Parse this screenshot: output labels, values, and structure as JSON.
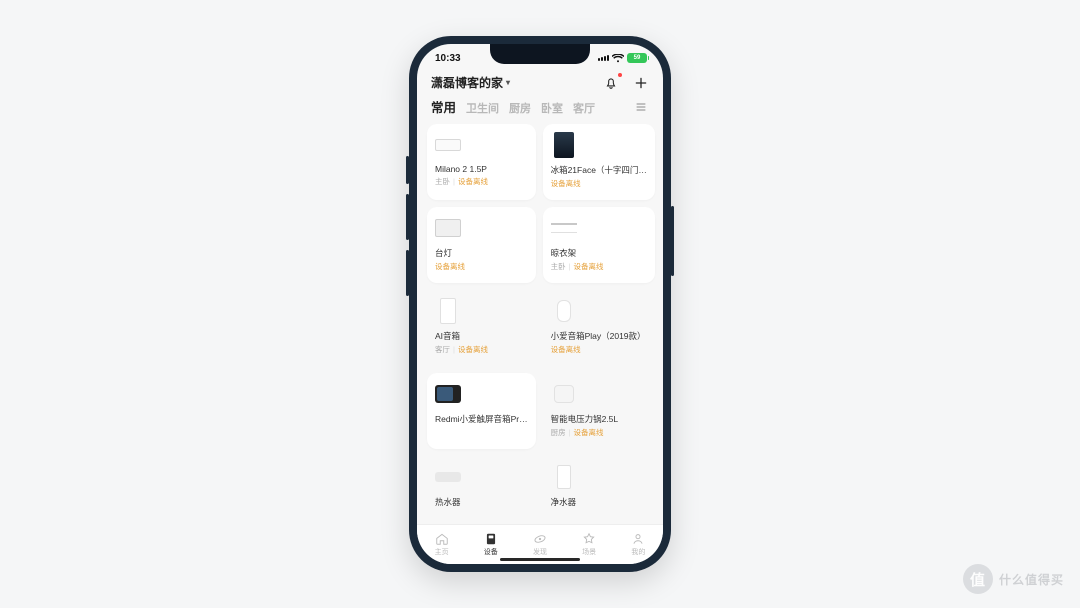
{
  "status": {
    "time": "10:33",
    "battery": "59"
  },
  "header": {
    "home_name": "潇磊博客的家",
    "bell_icon": "bell-icon",
    "plus_icon": "plus-icon"
  },
  "tabs": {
    "items": [
      "常用",
      "卫生间",
      "厨房",
      "卧室",
      "客厅"
    ],
    "active_index": 0
  },
  "devices": [
    {
      "name": "Milano 2 1.5P",
      "room": "主卧",
      "status": "设备离线",
      "thumb": "ac",
      "style": "card"
    },
    {
      "name": "冰箱21Face（十字四门…",
      "room": "",
      "status": "设备离线",
      "thumb": "fridge",
      "style": "card"
    },
    {
      "name": "台灯",
      "room": "",
      "status": "设备离线",
      "thumb": "monitor",
      "style": "card"
    },
    {
      "name": "晾衣架",
      "room": "主卧",
      "status": "设备离线",
      "thumb": "rack",
      "style": "card"
    },
    {
      "name": "AI音箱",
      "room": "客厅",
      "status": "设备离线",
      "thumb": "box",
      "style": "flat"
    },
    {
      "name": "小爱音箱Play（2019款）",
      "room": "",
      "status": "设备离线",
      "thumb": "speaker",
      "style": "flat"
    },
    {
      "name": "Redmi小爱触屏音箱Pr…",
      "room": "",
      "status": "",
      "thumb": "redmi",
      "style": "card"
    },
    {
      "name": "智能电压力锅2.5L",
      "room": "厨房",
      "status": "设备离线",
      "thumb": "pot",
      "style": "flat"
    },
    {
      "name": "热水器",
      "room": "",
      "status": "",
      "thumb": "heater",
      "style": "flat"
    },
    {
      "name": "净水器",
      "room": "",
      "status": "",
      "thumb": "purifier",
      "style": "flat"
    }
  ],
  "bottom_nav": {
    "items": [
      {
        "label": "主页",
        "icon": "home"
      },
      {
        "label": "设备",
        "icon": "device"
      },
      {
        "label": "发现",
        "icon": "discover"
      },
      {
        "label": "场景",
        "icon": "scene"
      },
      {
        "label": "我的",
        "icon": "me"
      }
    ],
    "active_index": 1
  },
  "watermark": {
    "badge": "值",
    "text": "什么值得买"
  }
}
